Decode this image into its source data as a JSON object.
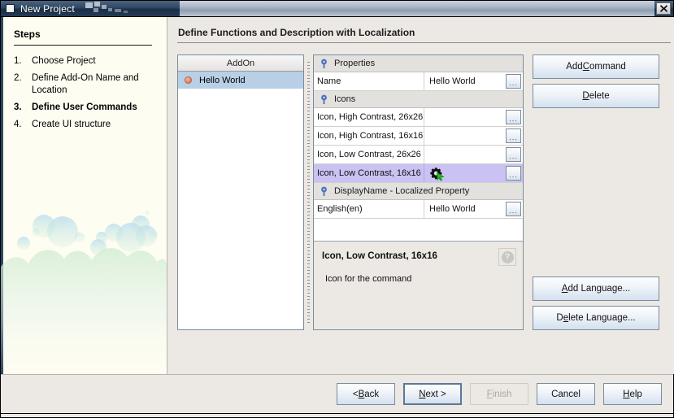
{
  "window": {
    "title": "New Project",
    "icon": "window-icon",
    "close_label": "x"
  },
  "steps": {
    "heading": "Steps",
    "items": [
      {
        "num": "1.",
        "label": "Choose Project",
        "current": false
      },
      {
        "num": "2.",
        "label": "Define Add-On Name and Location",
        "current": false
      },
      {
        "num": "3.",
        "label": "Define User Commands",
        "current": true
      },
      {
        "num": "4.",
        "label": "Create UI structure",
        "current": false
      }
    ]
  },
  "main": {
    "title": "Define Functions and Description with Localization",
    "tree": {
      "header": "AddOn",
      "items": [
        {
          "label": "Hello World",
          "selected": true
        }
      ]
    },
    "grid": {
      "rows": [
        {
          "type": "group",
          "name": "Properties"
        },
        {
          "type": "prop",
          "name": "Name",
          "value": "Hello World",
          "button": "...",
          "selected": false
        },
        {
          "type": "group",
          "name": "Icons"
        },
        {
          "type": "prop",
          "name": "Icon, High Contrast, 26x26",
          "value": "",
          "button": "...",
          "selected": false
        },
        {
          "type": "prop",
          "name": "Icon, High Contrast, 16x16",
          "value": "",
          "button": "...",
          "selected": false
        },
        {
          "type": "prop",
          "name": "Icon, Low Contrast, 26x26",
          "value": "",
          "button": "...",
          "selected": false
        },
        {
          "type": "prop",
          "name": "Icon, Low Contrast, 16x16",
          "value": "",
          "button": "...",
          "selected": true,
          "icon": "gear-cursor-icon"
        },
        {
          "type": "group",
          "name": "DisplayName - Localized Property"
        },
        {
          "type": "prop",
          "name": "English(en)",
          "value": "Hello World",
          "button": "...",
          "selected": false
        }
      ]
    },
    "description": {
      "title": "Icon, Low Contrast, 16x16",
      "text": "Icon for the command",
      "help": "?"
    },
    "side_buttons": {
      "add_command": {
        "pre": "Add ",
        "key": "C",
        "post": "ommand"
      },
      "delete": {
        "pre": "",
        "key": "D",
        "post": "elete"
      },
      "add_language": {
        "pre": "",
        "key": "A",
        "post": "dd Language..."
      },
      "delete_language": {
        "pre": "D",
        "key": "e",
        "post": "lete Language..."
      }
    }
  },
  "bottom_buttons": [
    {
      "pre": "< ",
      "key": "B",
      "post": "ack",
      "state": "normal",
      "name": "back-button"
    },
    {
      "pre": "",
      "key": "N",
      "post": "ext >",
      "state": "focus",
      "name": "next-button"
    },
    {
      "pre": "",
      "key": "F",
      "post": "inish",
      "state": "disabled",
      "name": "finish-button"
    },
    {
      "pre": "",
      "key": "C",
      "post": "ancel",
      "state": "normal",
      "name": "cancel-button"
    },
    {
      "pre": "",
      "key": "H",
      "post": "elp",
      "state": "normal",
      "name": "help-button"
    }
  ],
  "colors": {
    "titlebar": "#243b55",
    "selection_tree": "#b8cfe5",
    "selection_grid": "#c9c2f2",
    "panel": "#ece9e4",
    "steps_bg": "#fdfdf1"
  }
}
